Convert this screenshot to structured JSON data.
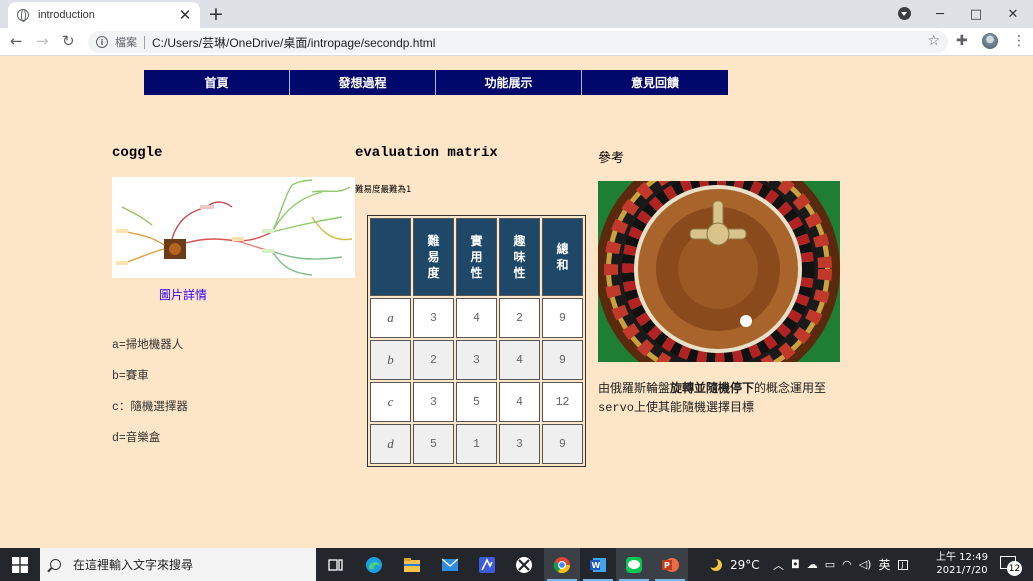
{
  "browser": {
    "tab_title": "introduction",
    "tab_close": "✕",
    "new_tab": "+",
    "secure_label": "檔案",
    "url": "C:/Users/芸琳/OneDrive/桌面/intropage/secondp.html",
    "icons": [
      "globe-icon",
      "back-arrow-icon",
      "forward-arrow-icon",
      "reload-icon",
      "info-icon",
      "star-icon",
      "extensions-icon",
      "profile-icon",
      "kebab-menu-icon"
    ]
  },
  "site_nav": {
    "items": [
      "首頁",
      "發想過程",
      "功能展示",
      "意見回饋"
    ]
  },
  "coggle": {
    "heading": "coggle",
    "image_link": "圖片詳情",
    "legend": [
      "a=掃地機器人",
      "b=賽車",
      "c：隨機選擇器",
      "d=音樂盒"
    ]
  },
  "matrix": {
    "heading": "evaluation matrix",
    "note": "難易度最難為1",
    "headers": [
      "難易度",
      "實用性",
      "趣味性",
      "總和"
    ],
    "rows": [
      {
        "label": "a",
        "values": [
          "3",
          "4",
          "2",
          "9"
        ]
      },
      {
        "label": "b",
        "values": [
          "2",
          "3",
          "4",
          "9"
        ]
      },
      {
        "label": "c",
        "values": [
          "3",
          "5",
          "4",
          "12"
        ]
      },
      {
        "label": "d",
        "values": [
          "5",
          "1",
          "3",
          "9"
        ]
      }
    ]
  },
  "reference": {
    "heading": "參考",
    "text_pre": "由俄羅斯輪盤",
    "text_bold": "旋轉並隨機停下",
    "text_mid": "的概念運用至",
    "text_mono": "servo",
    "text_post": "上使其能隨機選擇目標"
  },
  "taskbar": {
    "search_placeholder": "在這裡輸入文字來搜尋",
    "weather": "29°C",
    "ime": "英",
    "time": "上午 12:49",
    "date": "2021/7/20",
    "notification_count": "12",
    "colors": {
      "bar": "#23262b",
      "accent": "#76b9ed"
    }
  },
  "colors": {
    "page_bg": "#fde6c7",
    "nav_bg": "#00086b",
    "table_header_bg": "#1f4768",
    "link": "#3300ff"
  }
}
